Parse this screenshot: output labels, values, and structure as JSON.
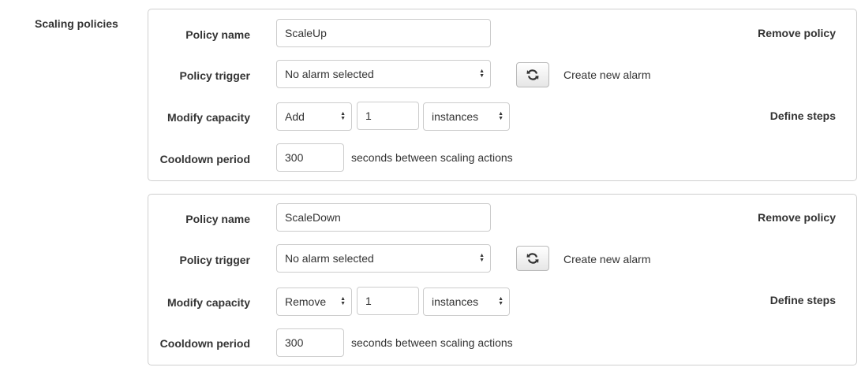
{
  "section": {
    "label": "Scaling policies"
  },
  "labels": {
    "policy_name": "Policy name",
    "policy_trigger": "Policy trigger",
    "modify_capacity": "Modify capacity",
    "cooldown_period": "Cooldown period",
    "remove_policy": "Remove policy",
    "create_new_alarm": "Create new alarm",
    "define_steps": "Define steps",
    "cooldown_suffix": "seconds between scaling actions"
  },
  "icons": {
    "refresh": "refresh-icon",
    "select_arrows": "updown-arrows-icon"
  },
  "policies": [
    {
      "name": "ScaleUp",
      "trigger": "No alarm selected",
      "capacity_action": "Add",
      "capacity_amount": "1",
      "capacity_unit": "instances",
      "cooldown": "300"
    },
    {
      "name": "ScaleDown",
      "trigger": "No alarm selected",
      "capacity_action": "Remove",
      "capacity_amount": "1",
      "capacity_unit": "instances",
      "cooldown": "300"
    }
  ]
}
